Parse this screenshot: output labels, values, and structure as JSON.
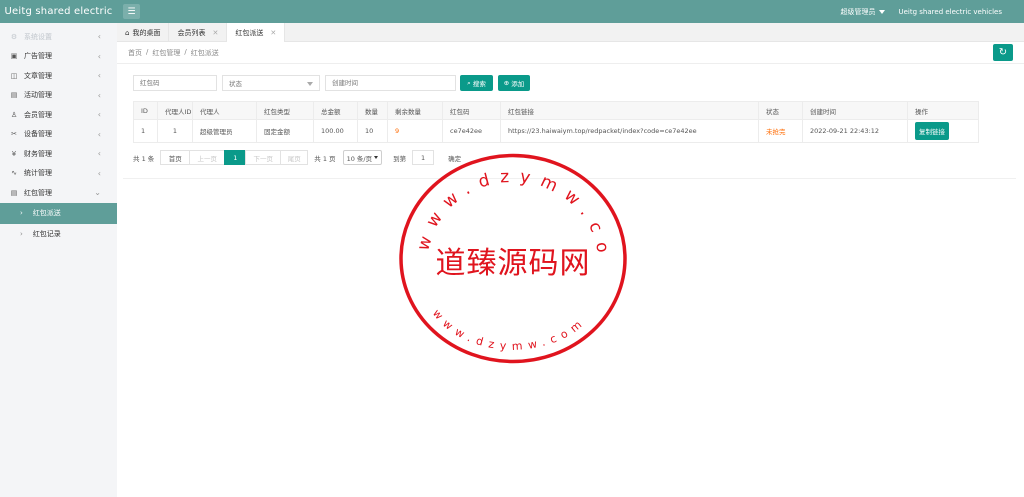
{
  "header": {
    "logo": "Ueitg shared electric",
    "admin": "超级管理员",
    "site_name": "Ueitg shared electric vehicles"
  },
  "sidebar": {
    "items": [
      {
        "label": "系统设置",
        "icon": "gear-icon"
      },
      {
        "label": "广告管理",
        "icon": "image-icon"
      },
      {
        "label": "文章管理",
        "icon": "book-icon"
      },
      {
        "label": "活动管理",
        "icon": "gift-icon"
      },
      {
        "label": "会员管理",
        "icon": "user-icon"
      },
      {
        "label": "设备管理",
        "icon": "device-icon"
      },
      {
        "label": "财务管理",
        "icon": "money-icon"
      },
      {
        "label": "统计管理",
        "icon": "chart-icon"
      },
      {
        "label": "红包管理",
        "icon": "gift-icon"
      }
    ],
    "subitems": [
      {
        "label": "红包派送"
      },
      {
        "label": "红包记录"
      }
    ]
  },
  "tabs": [
    {
      "label": "我的桌面"
    },
    {
      "label": "会员列表"
    },
    {
      "label": "红包派送"
    }
  ],
  "breadcrumb": [
    "首页",
    "红包管理",
    "红包派送"
  ],
  "breadcrumb_sep": "/",
  "filters": {
    "code_placeholder": "红包码",
    "status_placeholder": "状态",
    "time_placeholder": "创建时间",
    "search_label": "搜索",
    "add_label": "添加"
  },
  "table": {
    "headers": [
      "ID",
      "代理人ID",
      "代理人",
      "红包类型",
      "总金额",
      "数量",
      "剩余数量",
      "红包码",
      "红包链接",
      "状态",
      "创建时间",
      "操作"
    ],
    "rows": [
      {
        "id": "1",
        "agent_id": "1",
        "agent": "超级管理员",
        "type": "固定金额",
        "total": "100.00",
        "count": "10",
        "remaining": "9",
        "code": "ce7e42ee",
        "link": "https://23.haiwaiym.top/redpacket/index?code=ce7e42ee",
        "status": "未抢完",
        "created": "2022-09-21 22:43:12",
        "action": "复制链接"
      }
    ]
  },
  "pagination": {
    "total": "共 1 条",
    "first": "首页",
    "prev": "上一页",
    "current": "1",
    "next": "下一页",
    "last": "尾页",
    "pages": "共 1 页",
    "per_page": "10 条/页",
    "goto": "到第",
    "goto_value": "1",
    "confirm": "确定"
  },
  "watermark": {
    "title": "道臻源码网",
    "url_top": "www.dzymw.com",
    "url_bottom": "www.dzymw.com"
  },
  "colors": {
    "header": "#5f9e99",
    "accent": "#0a9a8a",
    "stamp": "#e0141e",
    "orange": "#ff6a00"
  }
}
